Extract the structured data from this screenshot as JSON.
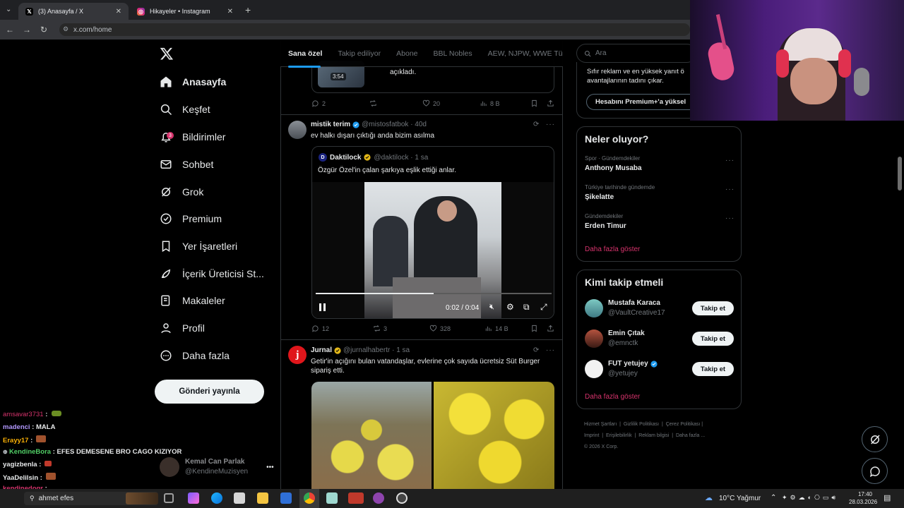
{
  "browser": {
    "tabs": [
      {
        "title": "(3) Anasayfa / X",
        "favicon": "X"
      },
      {
        "title": "Hikayeler • Instagram",
        "favicon": "ig"
      }
    ],
    "url": "x.com/home"
  },
  "nav": {
    "logo": "X",
    "items": [
      {
        "label": "Anasayfa",
        "icon": "home-icon"
      },
      {
        "label": "Keşfet",
        "icon": "search-icon"
      },
      {
        "label": "Bildirimler",
        "icon": "bell-icon",
        "badge": "3"
      },
      {
        "label": "Sohbet",
        "icon": "mail-icon"
      },
      {
        "label": "Grok",
        "icon": "grok-icon"
      },
      {
        "label": "Premium",
        "icon": "premium-icon"
      },
      {
        "label": "Yer İşaretleri",
        "icon": "bookmark-icon"
      },
      {
        "label": "İçerik Üreticisi St...",
        "icon": "rocket-icon"
      },
      {
        "label": "Makaleler",
        "icon": "article-icon"
      },
      {
        "label": "Profil",
        "icon": "profile-icon"
      },
      {
        "label": "Daha fazla",
        "icon": "more-icon"
      }
    ],
    "post_button": "Gönderi yayınla",
    "account": {
      "name": "Kemal Can Parlak",
      "handle": "@KendineMuzisyen"
    }
  },
  "feed": {
    "tabs": [
      "Sana özel",
      "Takip ediliyor",
      "Abone",
      "BBL Nobles",
      "AEW, NJPW, WWE Türki"
    ],
    "partial_post": {
      "text": "açıkladı.",
      "duration": "3:54",
      "replies": "2",
      "likes": "20",
      "views": "8 B"
    },
    "post1": {
      "name": "mistik terim",
      "handle": "@mistosfatbok · 40d",
      "text": "ev halkı dışarı çıktığı anda bizim asılma",
      "quote": {
        "name": "Daktilock",
        "handle": "@daktilock · 1 sa",
        "text": "Özgür Özel'in çalan şarkıya eşlik ettiği anlar.",
        "video_time": "0:02 / 0:04",
        "progress": 0.5
      },
      "replies": "12",
      "reposts": "3",
      "likes": "328",
      "views": "14 B"
    },
    "post2": {
      "name": "Jurnal",
      "handle": "@jurnalhabertr · 1 sa",
      "text": "Getir'in açığını bulan vatandaşlar, evlerine çok sayıda ücretsiz Süt Burger sipariş etti."
    }
  },
  "right": {
    "search_placeholder": "Ara",
    "premium_text": "Sıfır reklam ve en yüksek yanıt ö avantajlarının tadını çıkar.",
    "premium_button": "Hesabını Premium+'a yüksel",
    "trends_title": "Neler oluyor?",
    "trends": [
      {
        "category": "Spor · Gündemdekiler",
        "name": "Anthony Musaba"
      },
      {
        "category": "Türkiye tarihinde gündemde",
        "name": "Şikelatte"
      },
      {
        "category": "Gündemdekiler",
        "name": "Erden Timur"
      }
    ],
    "show_more": "Daha fazla göster",
    "follow_title": "Kimi takip etmeli",
    "follow": [
      {
        "name": "Mustafa Karaca",
        "handle": "@VaultCreative17"
      },
      {
        "name": "Emin Çıtak",
        "handle": "@emnctk"
      },
      {
        "name": "FUT yetujey",
        "handle": "@yetujey"
      }
    ],
    "follow_button": "Takip et",
    "footer": [
      "Hizmet Şartları",
      "Gizlilik Politikası",
      "Çerez Politikası",
      "Imprint",
      "Erişilebilirlik",
      "Reklam bilgisi",
      "Daha fazla ...",
      "© 2026 X Corp."
    ]
  },
  "chat": [
    {
      "user": "amsavar3731",
      "msg": "",
      "color": "#d6336c"
    },
    {
      "user": "madenci",
      "msg": "MALA",
      "color": "#b197fc"
    },
    {
      "user": "Erayy17",
      "msg": "",
      "color": "#fab005"
    },
    {
      "user": "KendineBora",
      "msg": "EFES DEMESENE BRO CAGO KIZIYOR",
      "color": "#51cf66"
    },
    {
      "user": "yagizbenla",
      "msg": "",
      "color": "#e7e9ea"
    },
    {
      "user": "YaaDelilsin",
      "msg": "",
      "color": "#e7e9ea"
    },
    {
      "user": "kendinedogr",
      "msg": "",
      "color": "#d6336c"
    },
    {
      "user": "",
      "msg": "ahmet efes",
      "color": "#e7e9ea"
    }
  ],
  "taskbar": {
    "weather": "10°C  Yağmur",
    "time": "17:40",
    "date": "28.03.2026"
  }
}
